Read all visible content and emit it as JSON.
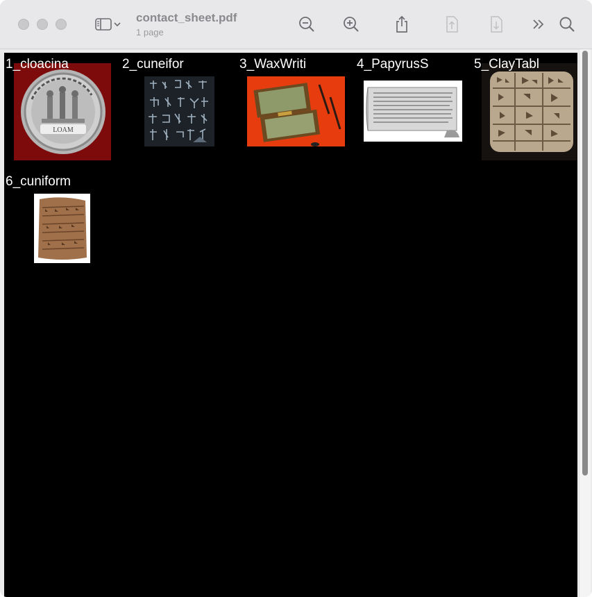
{
  "window": {
    "title": "contact_sheet.pdf",
    "subtitle": "1 page"
  },
  "toolbar": {
    "icons": [
      "sidebar-icon",
      "chevron-down-icon",
      "zoom-out-icon",
      "zoom-in-icon",
      "share-icon",
      "previous-page-icon",
      "next-page-icon",
      "more-icon",
      "search-icon"
    ]
  },
  "thumbnails": [
    {
      "label": "1_cloacina",
      "subject": "silver coin on red background"
    },
    {
      "label": "2_cuneifor",
      "subject": "cuneiform signs on dark tablet"
    },
    {
      "label": "3_WaxWriti",
      "subject": "wax writing tablet with styli on red"
    },
    {
      "label": "4_PapyrusS",
      "subject": "papyrus scroll"
    },
    {
      "label": "5_ClayTabl",
      "subject": "clay tablet with cuneiform"
    },
    {
      "label": "6_cuniform",
      "subject": "small clay tablet"
    }
  ],
  "colors": {
    "content_bg": "#000000",
    "toolbar_bg": "#e8e8ea",
    "label_text": "#ffffff"
  }
}
